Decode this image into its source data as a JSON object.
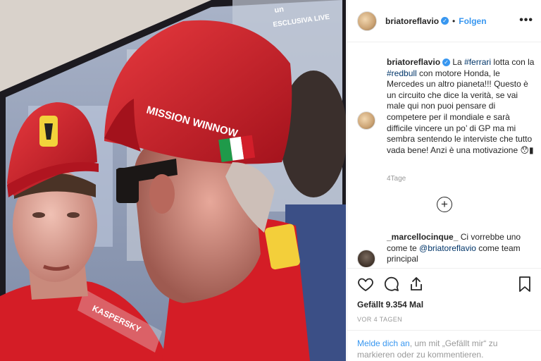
{
  "post": {
    "username": "briatoreflavio",
    "follow_label": "Folgen",
    "more_label": "•••",
    "separator": "•",
    "photo_overlay_text": "ESCLUSIVA LIVE",
    "photo_overlay_text2": "un",
    "cap_logo": "MISSION WINNOW",
    "suit_text": "KASPERSKY"
  },
  "caption": {
    "username": "briatoreflavio",
    "pre1": " La ",
    "tag1": "#ferrari",
    "pre2": " lotta con la ",
    "tag2": "#redbull",
    "rest": " con motore Honda, le Mercedes un altro pianeta!!! Questo è un circuito che dice la verità, se vai male qui non puoi pensare di competere per il mondiale e sarà difficile vincere un po’ di GP ma mi sembra sentendo le interviste che tutto vada bene! Anzi è una motivazione 😯▮",
    "age": "4Tage"
  },
  "load_more_label": "+",
  "comment": {
    "username": "_marcellocinque_",
    "pre": " Ci vorrebbe uno come te ",
    "mention": "@briatoreflavio",
    "rest": " come team principal"
  },
  "stats": {
    "likes": "Gefällt 9.354 Mal",
    "age": "VOR 4 TAGEN"
  },
  "login_prompt": {
    "link": "Melde dich an",
    "rest": ", um mit „Gefällt mir“ zu markieren oder zu kommentieren."
  },
  "icons": [
    "heart-icon",
    "comment-icon",
    "share-icon",
    "bookmark-icon"
  ],
  "colors": {
    "accent": "#3897f0",
    "tag": "#003569",
    "muted": "#999999",
    "ferrari_red": "#d71920"
  }
}
